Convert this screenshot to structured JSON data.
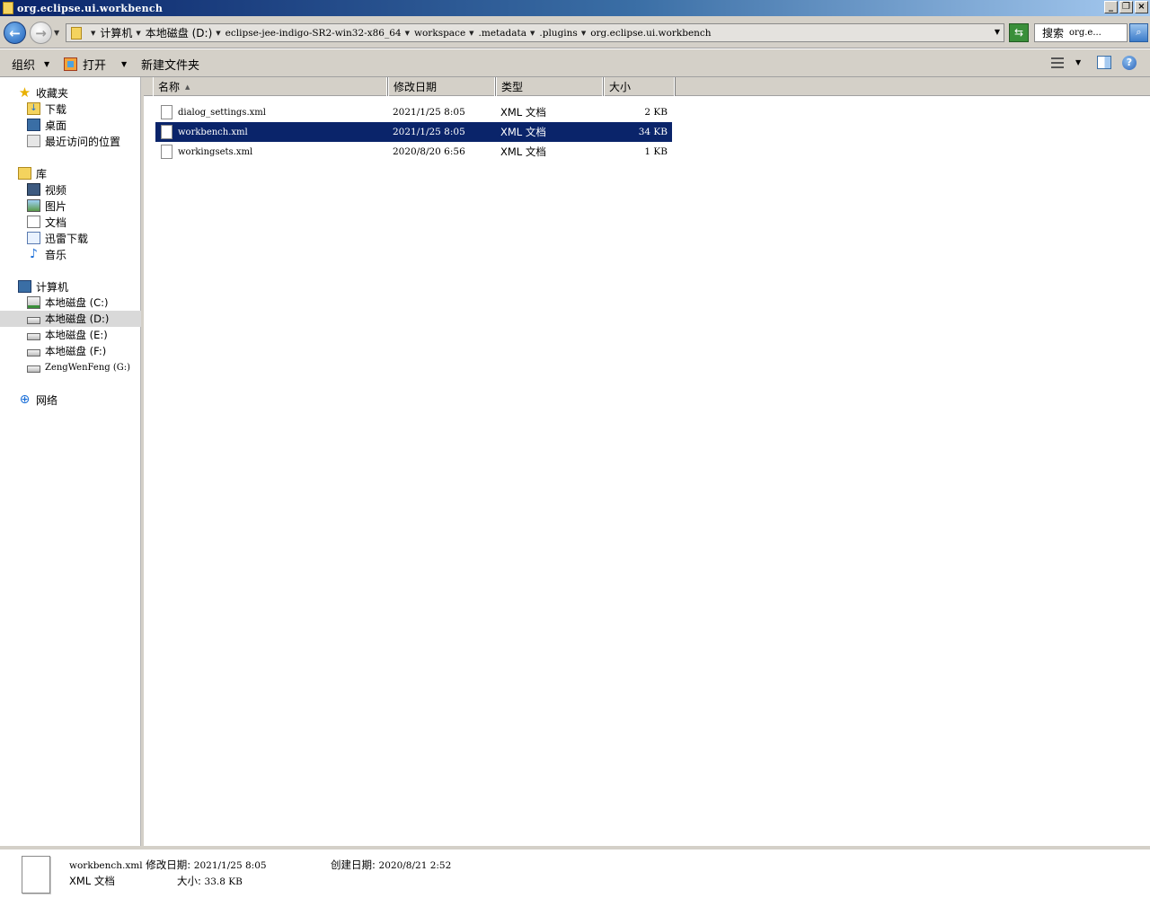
{
  "window": {
    "title": "org.eclipse.ui.workbench",
    "buttons": {
      "minimize": "_",
      "restore": "❐",
      "close": "×"
    }
  },
  "address": {
    "crumbs": [
      "计算机",
      "本地磁盘 (D:)",
      "eclipse-jee-indigo-SR2-win32-x86_64",
      "workspace",
      ".metadata",
      ".plugins",
      "org.eclipse.ui.workbench"
    ],
    "search_label": "搜索",
    "search_value": "org.e..."
  },
  "toolbar": {
    "organize": "组织",
    "open": "打开",
    "new_folder": "新建文件夹"
  },
  "nav": {
    "favorites": {
      "label": "收藏夹",
      "items": [
        "下载",
        "桌面",
        "最近访问的位置"
      ]
    },
    "libraries": {
      "label": "库",
      "items": [
        "视频",
        "图片",
        "文档",
        "迅雷下载",
        "音乐"
      ]
    },
    "computer": {
      "label": "计算机",
      "drives": [
        {
          "label": "本地磁盘 (C:)"
        },
        {
          "label": "本地磁盘 (D:)",
          "selected": true
        },
        {
          "label": "本地磁盘 (E:)"
        },
        {
          "label": "本地磁盘 (F:)"
        },
        {
          "label": "ZengWenFeng (G:)"
        }
      ]
    },
    "network": {
      "label": "网络"
    }
  },
  "columns": {
    "name": "名称",
    "modified": "修改日期",
    "type": "类型",
    "size": "大小"
  },
  "files": [
    {
      "name": "dialog_settings.xml",
      "modified": "2021/1/25 8:05",
      "type": "XML 文档",
      "size": "2 KB",
      "selected": false
    },
    {
      "name": "workbench.xml",
      "modified": "2021/1/25 8:05",
      "type": "XML 文档",
      "size": "34 KB",
      "selected": true
    },
    {
      "name": "workingsets.xml",
      "modified": "2020/8/20 6:56",
      "type": "XML 文档",
      "size": "1 KB",
      "selected": false
    }
  ],
  "details": {
    "filename": "workbench.xml",
    "modified_label": "修改日期:",
    "modified": "2021/1/25 8:05",
    "created_label": "创建日期:",
    "created": "2020/8/21 2:52",
    "type": "XML 文档",
    "size_label": "大小:",
    "size": "33.8 KB"
  },
  "colors": {
    "selection": "#0a246a",
    "title_start": "#0a246a",
    "title_end": "#a6caf0",
    "chrome": "#d4d0c8"
  }
}
